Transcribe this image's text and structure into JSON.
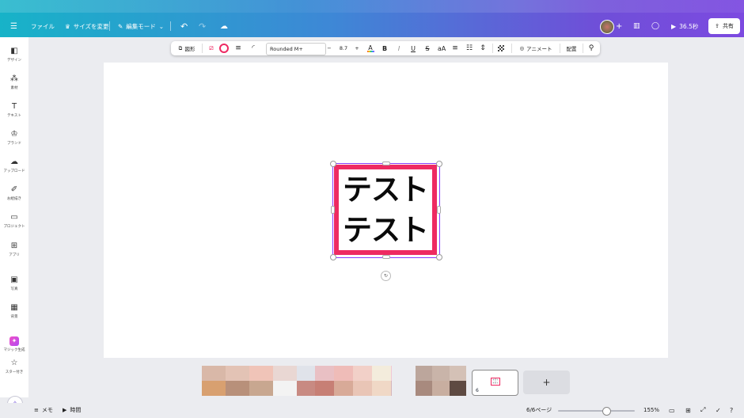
{
  "topbar": {
    "menu_icon": "hamburger-icon",
    "file_label": "ファイル",
    "resize_label": "サイズを変更",
    "edit_mode_label": "編集モード",
    "timer_label": "36.5秒",
    "share_label": "共有"
  },
  "toolbar": {
    "shape_label": "図形",
    "font_name": "Rounded M+",
    "font_size": "8.7",
    "minus": "−",
    "plus": "+",
    "bold": "B",
    "italic": "I",
    "underline": "U",
    "strike": "S",
    "case": "aA",
    "animate_label": "アニメート",
    "position_label": "配置",
    "accent_color": "#ee2a62"
  },
  "sidebar": {
    "items": [
      {
        "label": "デザイン",
        "icon": "layout-icon"
      },
      {
        "label": "素材",
        "icon": "elements-icon"
      },
      {
        "label": "テキスト",
        "icon": "text-icon"
      },
      {
        "label": "ブランド",
        "icon": "brand-icon"
      },
      {
        "label": "アップロード",
        "icon": "upload-icon"
      },
      {
        "label": "お絵描き",
        "icon": "draw-icon"
      },
      {
        "label": "プロジェクト",
        "icon": "folder-icon"
      },
      {
        "label": "アプリ",
        "icon": "apps-icon"
      },
      {
        "label": "写真",
        "icon": "photo-icon"
      },
      {
        "label": "背景",
        "icon": "background-icon"
      },
      {
        "label": "マジック生成",
        "icon": "magic-icon"
      },
      {
        "label": "スター付き",
        "icon": "star-icon"
      }
    ]
  },
  "canvas": {
    "text_line1": "テスト",
    "text_line2": "テスト",
    "border_color": "#ee2a62"
  },
  "pages": {
    "current_page_number": "6",
    "thumb_text": "テスト テスト",
    "add_label": "+"
  },
  "bottombar": {
    "notes_label": "メモ",
    "timer_label": "時間",
    "page_indicator": "6/6ページ",
    "zoom_label": "155%",
    "zoom_level": 0.63
  }
}
